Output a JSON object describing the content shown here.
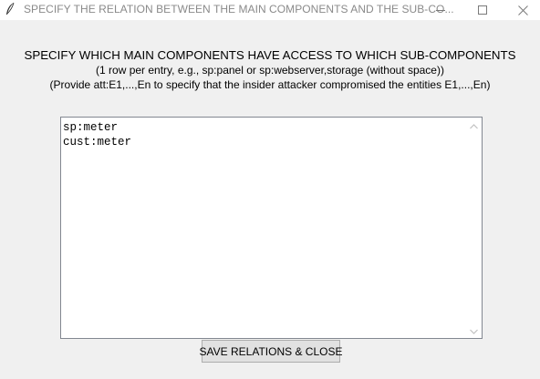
{
  "window": {
    "title": "SPECIFY THE RELATION BETWEEN THE MAIN COMPONENTS AND THE SUB-CO...",
    "controls": {
      "minimize_icon": "minimize-icon",
      "maximize_icon": "maximize-icon",
      "close_icon": "close-icon"
    }
  },
  "instructions": {
    "heading": "SPECIFY WHICH MAIN COMPONENTS HAVE ACCESS TO WHICH SUB-COMPONENTS",
    "line1": "(1 row per entry, e.g., sp:panel or sp:webserver,storage (without space))",
    "line2": "(Provide att:E1,...,En to specify that the insider attacker compromised the entities E1,...,En)"
  },
  "editor": {
    "value": "sp:meter\ncust:meter"
  },
  "actions": {
    "save_label": "SAVE RELATIONS & CLOSE"
  }
}
